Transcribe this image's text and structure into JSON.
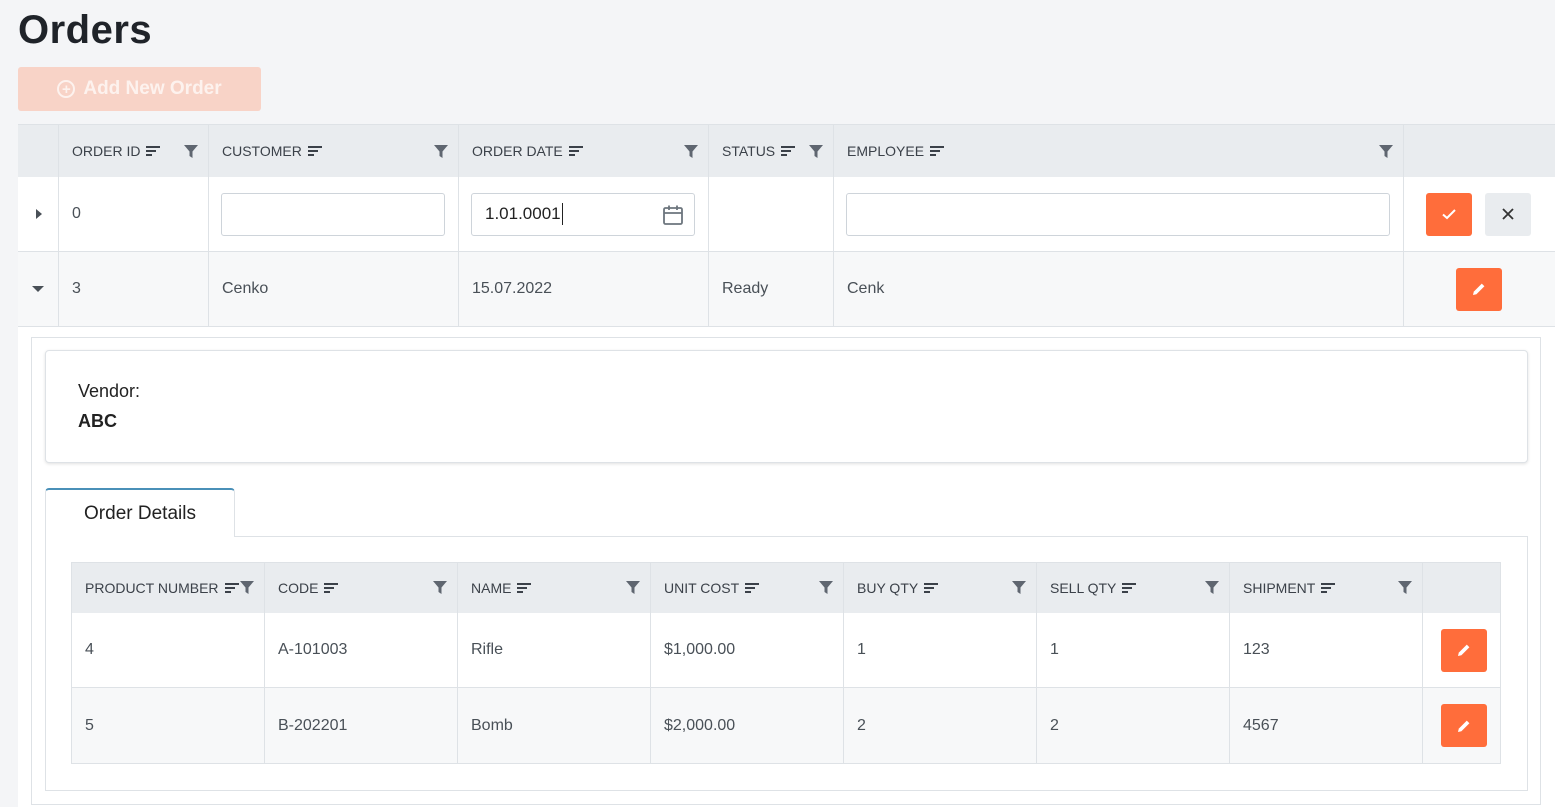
{
  "page": {
    "title": "Orders"
  },
  "toolbar": {
    "add_label": "Add New Order"
  },
  "grid": {
    "columns": [
      "ORDER ID",
      "CUSTOMER",
      "ORDER DATE",
      "STATUS",
      "EMPLOYEE"
    ],
    "edit_row": {
      "order_id": "0",
      "customer_value": "",
      "order_date_value": "1.01.0001",
      "employee_value": ""
    },
    "rows": [
      {
        "order_id": "3",
        "customer": "Cenko",
        "order_date": "15.07.2022",
        "status": "Ready",
        "employee": "Cenk"
      }
    ]
  },
  "detail": {
    "vendor_label": "Vendor:",
    "vendor_value": "ABC",
    "tab_label": "Order Details",
    "columns": [
      "PRODUCT NUMBER",
      "CODE",
      "NAME",
      "UNIT COST",
      "BUY QTY",
      "SELL QTY",
      "SHIPMENT"
    ],
    "rows": [
      {
        "product_number": "4",
        "code": "A-101003",
        "name": "Rifle",
        "unit_cost": "$1,000.00",
        "buy_qty": "1",
        "sell_qty": "1",
        "shipment": "123"
      },
      {
        "product_number": "5",
        "code": "B-202201",
        "name": "Bomb",
        "unit_cost": "$2,000.00",
        "buy_qty": "2",
        "sell_qty": "2",
        "shipment": "4567"
      }
    ]
  },
  "colors": {
    "accent": "#ff6d3b",
    "header_bg": "#e9ecef",
    "tab_top": "#4a90b8"
  }
}
